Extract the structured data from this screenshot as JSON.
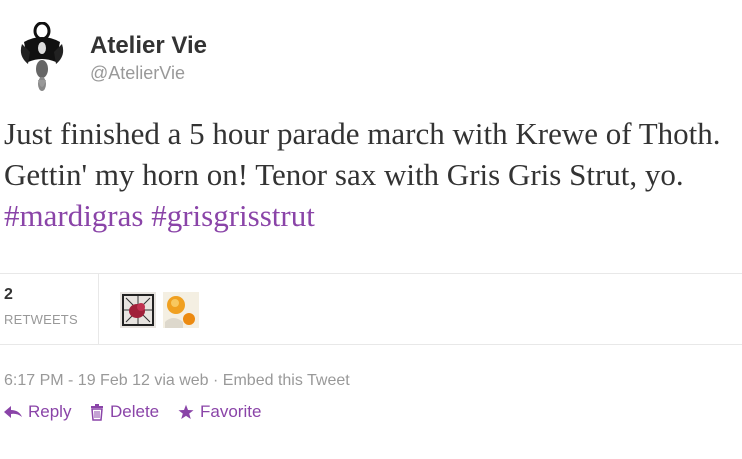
{
  "author": {
    "name": "Atelier Vie",
    "handle": "@AtelierVie"
  },
  "tweet": {
    "text_plain": "Just finished a 5 hour parade march with Krewe of Thoth. Gettin' my horn on! Tenor sax with Gris Gris Strut, yo.",
    "hashtags": [
      "#mardigras",
      "#grisgrisstrut"
    ]
  },
  "stats": {
    "retweet_count": "2",
    "retweet_label": "RETWEETS"
  },
  "meta": {
    "time": "6:17 PM - 19 Feb 12",
    "via": "via web",
    "separator": "·",
    "embed": "Embed this Tweet"
  },
  "actions": {
    "reply": "Reply",
    "delete": "Delete",
    "favorite": "Favorite"
  },
  "icons": {
    "reply": "reply-icon",
    "delete": "trash-icon",
    "favorite": "star-icon"
  },
  "colors": {
    "accent": "#8a44a8",
    "muted": "#999999",
    "text": "#333333"
  }
}
